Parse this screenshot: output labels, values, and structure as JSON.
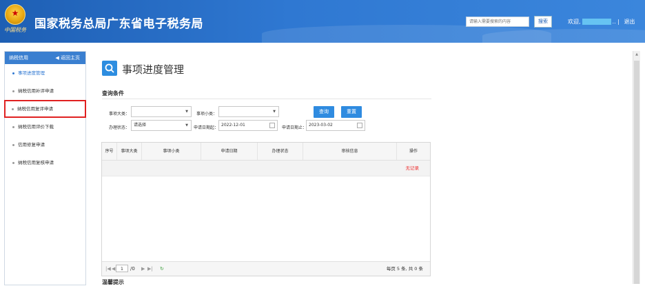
{
  "header": {
    "title": "国家税务总局广东省电子税务局",
    "seal_text": "中国税务",
    "search_placeholder": "请输入需要搜索的内容",
    "search_button": "搜索",
    "welcome": "欢迎,",
    "welcome_tail": "..",
    "logout": "退出",
    "separator": "|"
  },
  "sidebar": {
    "header": "纳税信用",
    "home_link": "返回主页",
    "items": [
      {
        "label": "事项进度管理"
      },
      {
        "label": "纳税信用补评申请"
      },
      {
        "label": "纳税信用复评申请"
      },
      {
        "label": "纳税信用评价下载"
      },
      {
        "label": "信用修复申请"
      },
      {
        "label": "纳税信用复核申请"
      }
    ]
  },
  "main": {
    "page_title": "事项进度管理",
    "query_section": "查询条件",
    "filters": {
      "category_label": "事项大类：",
      "category_value": "",
      "subcategory_label": "事项小类：",
      "subcategory_value": "",
      "status_label": "办理状态：",
      "status_value": "请选择",
      "date_from_label": "申请日期起：",
      "date_from_value": "2022-12-01",
      "date_to_label": "申请日期止：",
      "date_to_value": "2023-03-02"
    },
    "buttons": {
      "query": "查询",
      "reset": "重置"
    },
    "table": {
      "columns": [
        "序号",
        "事项大类",
        "事项小类",
        "申请日期",
        "办理状态",
        "审核信息",
        "操作"
      ],
      "empty_text": "无记录"
    },
    "pager": {
      "page_input": "1",
      "page_total": "/0",
      "info": "每页 5 条, 共 0 条"
    },
    "tip_title": "温馨提示"
  },
  "colors": {
    "header_bg": "#2f78d2",
    "accent": "#2f8be0",
    "highlight_box": "#e02020",
    "empty_text": "#ee3333"
  }
}
